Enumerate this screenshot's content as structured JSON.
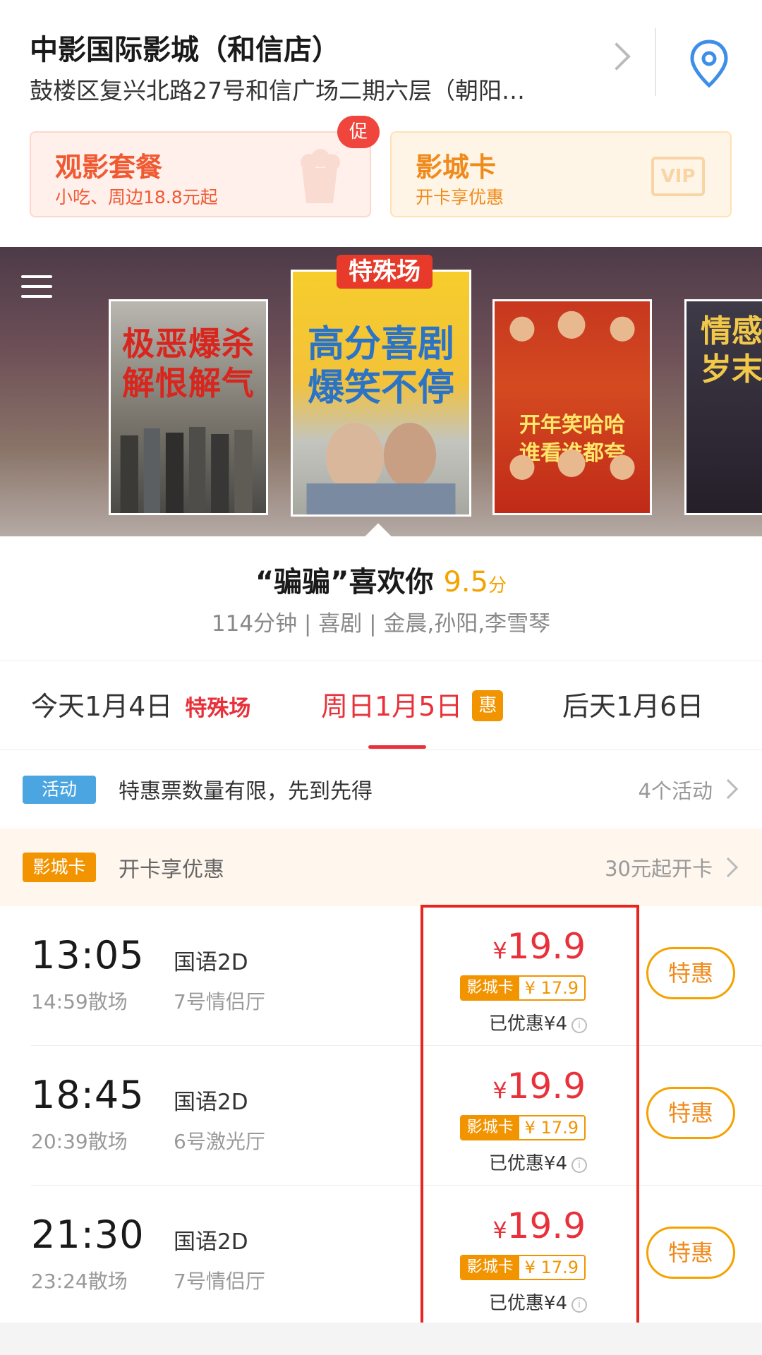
{
  "header": {
    "cinema_name": "中影国际影城（和信店）",
    "address": "鼓楼区复兴北路27号和信广场二期六层（朝阳…",
    "chevron_icon": "chevron-right-icon",
    "location_icon": "location-pin-icon"
  },
  "promos": {
    "combo": {
      "title": "观影套餐",
      "subtitle": "小吃、周边18.8元起",
      "badge": "促",
      "icon": "popcorn-icon"
    },
    "card": {
      "title": "影城卡",
      "subtitle": "开卡享优惠",
      "icon": "vip-card-icon",
      "icon_text": "VIP"
    }
  },
  "carousel": {
    "menu_icon": "menu-icon",
    "posters": [
      {
        "title": "极恶爆杀\n解恨解气"
      },
      {
        "tag": "特殊场",
        "title": "高分喜剧\n爆笑不停"
      },
      {
        "title": "开年笑哈哈\n谁看谁都夸"
      },
      {
        "title": "情感\n岁末"
      }
    ]
  },
  "movie": {
    "title": "“骗骗”喜欢你",
    "score": "9.5",
    "score_unit": "分",
    "meta": "114分钟 | 喜剧 | 金晨,孙阳,李雪琴"
  },
  "date_tabs": [
    {
      "label": "今天1月4日",
      "tag": "特殊场",
      "active": false
    },
    {
      "label": "周日1月5日",
      "tag": "惠",
      "active": true
    },
    {
      "label": "后天1月6日",
      "active": false
    }
  ],
  "activity": {
    "tag": "活动",
    "text": "特惠票数量有限，先到先得",
    "count": "4个活动"
  },
  "cinema_card": {
    "tag": "影城卡",
    "text": "开卡享优惠",
    "price": "30元起开卡"
  },
  "showtimes": [
    {
      "start": "13:05",
      "end": "14:59散场",
      "lang": "国语2D",
      "hall": "7号情侣厅",
      "currency": "¥",
      "price": "19.9",
      "card_label": "影城卡",
      "card_price": "¥ 17.9",
      "discount": "已优惠¥4",
      "button": "特惠"
    },
    {
      "start": "18:45",
      "end": "20:39散场",
      "lang": "国语2D",
      "hall": "6号激光厅",
      "currency": "¥",
      "price": "19.9",
      "card_label": "影城卡",
      "card_price": "¥ 17.9",
      "discount": "已优惠¥4",
      "button": "特惠"
    },
    {
      "start": "21:30",
      "end": "23:24散场",
      "lang": "国语2D",
      "hall": "7号情侣厅",
      "currency": "¥",
      "price": "19.9",
      "card_label": "影城卡",
      "card_price": "¥ 17.9",
      "discount": "已优惠¥4",
      "button": "特惠"
    }
  ],
  "colors": {
    "accent_red": "#e8313a",
    "accent_orange": "#f29400",
    "score_yellow": "#f5a200",
    "activity_blue": "#4aa5e0",
    "highlight_box": "#e62521"
  }
}
